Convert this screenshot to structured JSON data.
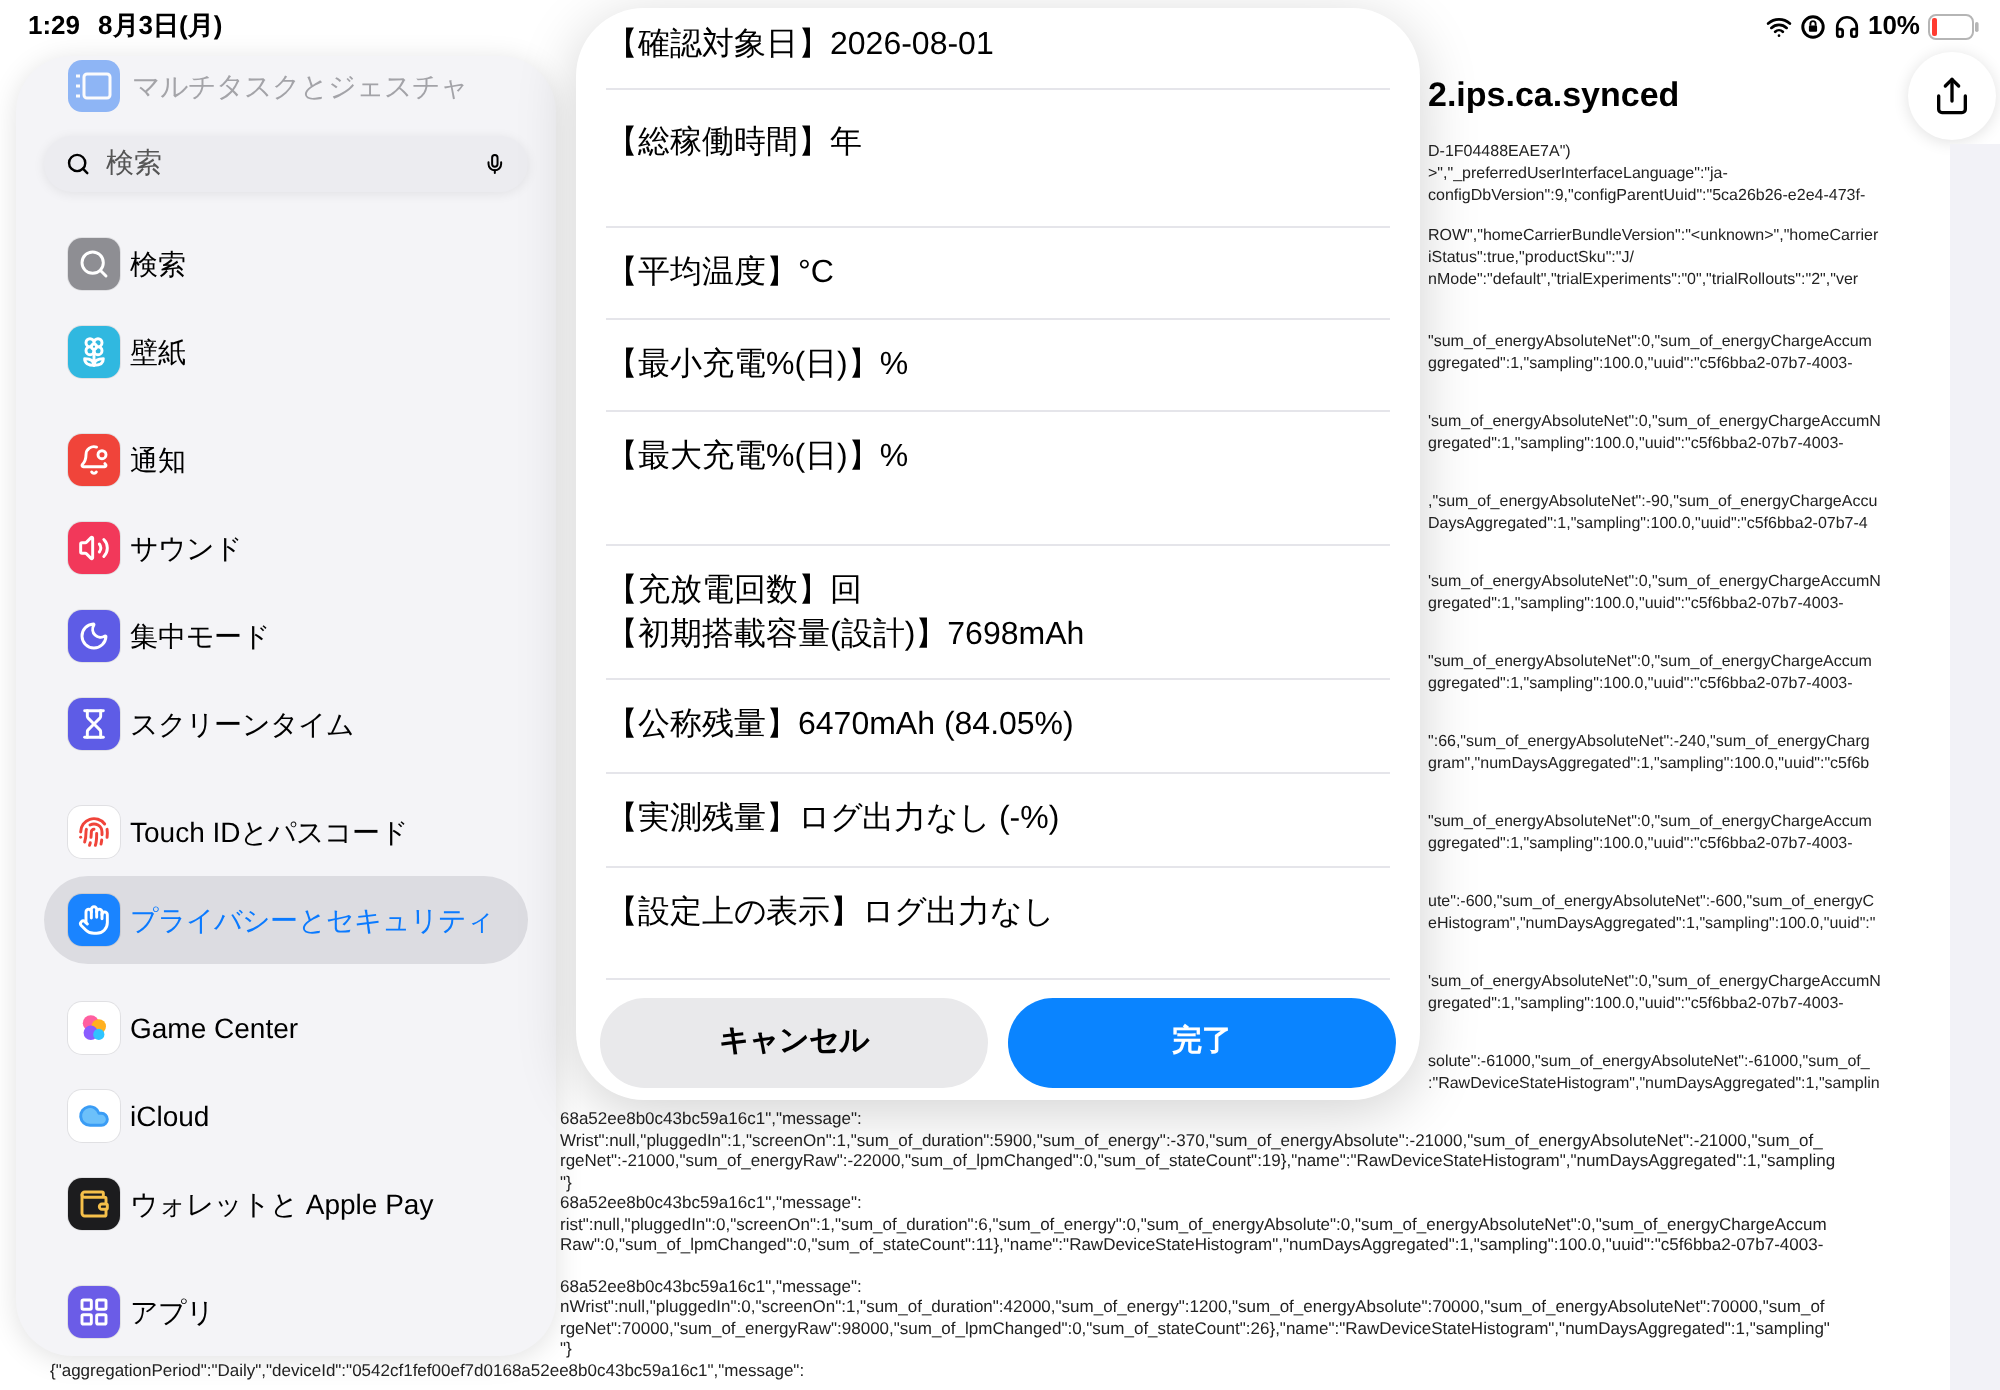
{
  "status_bar": {
    "time": "1:29",
    "date": "8月3日(月)",
    "battery": "10%"
  },
  "document": {
    "title": "2.ips.ca.synced",
    "upper_log": [
      [
        "D-1F04488EAE7A\")",
        ">\",\"_preferredUserInterfaceLanguage\":\"ja-",
        "configDbVersion\":9,\"configParentUuid\":\"5ca26b26-e2e4-473f-"
      ],
      [
        "ROW\",\"homeCarrierBundleVersion\":\"<unknown>\",\"homeCarrier",
        "iStatus\":true,\"productSku\":\"J/",
        "nMode\":\"default\",\"trialExperiments\":\"0\",\"trialRollouts\":\"2\",\"ver"
      ],
      [
        "\"sum_of_energyAbsoluteNet\":0,\"sum_of_energyChargeAccum",
        "ggregated\":1,\"sampling\":100.0,\"uuid\":\"c5f6bba2-07b7-4003-"
      ],
      [
        "'sum_of_energyAbsoluteNet\":0,\"sum_of_energyChargeAccumN",
        "gregated\":1,\"sampling\":100.0,\"uuid\":\"c5f6bba2-07b7-4003-"
      ],
      [
        ",\"sum_of_energyAbsoluteNet\":-90,\"sum_of_energyChargeAccu",
        "DaysAggregated\":1,\"sampling\":100.0,\"uuid\":\"c5f6bba2-07b7-4"
      ],
      [
        "'sum_of_energyAbsoluteNet\":0,\"sum_of_energyChargeAccumN",
        "gregated\":1,\"sampling\":100.0,\"uuid\":\"c5f6bba2-07b7-4003-"
      ],
      [
        "\"sum_of_energyAbsoluteNet\":0,\"sum_of_energyChargeAccum",
        "ggregated\":1,\"sampling\":100.0,\"uuid\":\"c5f6bba2-07b7-4003-"
      ],
      [
        "\":66,\"sum_of_energyAbsoluteNet\":-240,\"sum_of_energyCharg",
        "gram\",\"numDaysAggregated\":1,\"sampling\":100.0,\"uuid\":\"c5f6b"
      ],
      [
        "\"sum_of_energyAbsoluteNet\":0,\"sum_of_energyChargeAccum",
        "ggregated\":1,\"sampling\":100.0,\"uuid\":\"c5f6bba2-07b7-4003-"
      ],
      [
        "ute\":-600,\"sum_of_energyAbsoluteNet\":-600,\"sum_of_energyC",
        "eHistogram\",\"numDaysAggregated\":1,\"sampling\":100.0,\"uuid\":\""
      ],
      [
        "'sum_of_energyAbsoluteNet\":0,\"sum_of_energyChargeAccumN",
        "gregated\":1,\"sampling\":100.0,\"uuid\":\"c5f6bba2-07b7-4003-"
      ],
      [
        "solute\":-61000,\"sum_of_energyAbsoluteNet\":-61000,\"sum_of_",
        ":\"RawDeviceStateHistogram\",\"numDaysAggregated\":1,\"samplin"
      ]
    ],
    "lower_log": [
      [
        "68a52ee8b0c43bc59a16c1\",\"message\":",
        "Wrist\":null,\"pluggedIn\":1,\"screenOn\":1,\"sum_of_duration\":5900,\"sum_of_energy\":-370,\"sum_of_energyAbsolute\":-21000,\"sum_of_energyAbsoluteNet\":-21000,\"sum_of_",
        "rgeNet\":-21000,\"sum_of_energyRaw\":-22000,\"sum_of_lpmChanged\":0,\"sum_of_stateCount\":19},\"name\":\"RawDeviceStateHistogram\",\"numDaysAggregated\":1,\"sampling",
        "\"}",
        "68a52ee8b0c43bc59a16c1\",\"message\":",
        "rist\":null,\"pluggedIn\":0,\"screenOn\":1,\"sum_of_duration\":6,\"sum_of_energy\":0,\"sum_of_energyAbsolute\":0,\"sum_of_energyAbsoluteNet\":0,\"sum_of_energyChargeAccum",
        "Raw\":0,\"sum_of_lpmChanged\":0,\"sum_of_stateCount\":11},\"name\":\"RawDeviceStateHistogram\",\"numDaysAggregated\":1,\"sampling\":100.0,\"uuid\":\"c5f6bba2-07b7-4003-"
      ],
      [
        "68a52ee8b0c43bc59a16c1\",\"message\":",
        "nWrist\":null,\"pluggedIn\":0,\"screenOn\":1,\"sum_of_duration\":42000,\"sum_of_energy\":1200,\"sum_of_energyAbsolute\":70000,\"sum_of_energyAbsoluteNet\":70000,\"sum_of",
        "rgeNet\":70000,\"sum_of_energyRaw\":98000,\"sum_of_lpmChanged\":0,\"sum_of_stateCount\":26},\"name\":\"RawDeviceStateHistogram\",\"numDaysAggregated\":1,\"sampling\"",
        "\"}"
      ]
    ],
    "last_line": "{\"aggregationPeriod\":\"Daily\",\"deviceId\":\"0542cf1fef00ef7d0168a52ee8b0c43bc59a16c1\",\"message\":"
  },
  "sidebar": {
    "faded_item": "マルチタスクとジェスチャ",
    "search": {
      "placeholder": "検索"
    },
    "groups": [
      [
        {
          "label": "検索",
          "color": "#8e8e93",
          "selected": false
        },
        {
          "label": "壁紙",
          "color": "#30b8e0",
          "selected": false
        }
      ],
      [
        {
          "label": "通知",
          "color": "#f0443a",
          "selected": false
        },
        {
          "label": "サウンド",
          "color": "#f2385a",
          "selected": false
        },
        {
          "label": "集中モード",
          "color": "#5e5ce6",
          "selected": false
        },
        {
          "label": "スクリーンタイム",
          "color": "#5e5ce6",
          "selected": false
        }
      ],
      [
        {
          "label": "Touch IDとパスコード",
          "color": "#ffffff",
          "selected": false
        },
        {
          "label": "プライバシーとセキュリティ",
          "color": "#1a84ff",
          "selected": true
        }
      ],
      [
        {
          "label": "Game Center",
          "color": "#ffffff",
          "selected": false
        },
        {
          "label": "iCloud",
          "color": "#ffffff",
          "selected": false
        },
        {
          "label": "ウォレットと Apple Pay",
          "color": "#1c1c1e",
          "selected": false
        }
      ],
      [
        {
          "label": "アプリ",
          "color": "#6b5ce7",
          "selected": false
        }
      ]
    ]
  },
  "dialog": {
    "rows": [
      [
        "【確認対象日】2026-08-01"
      ],
      [
        "【総稼働時間】年"
      ],
      [
        "【平均温度】°C"
      ],
      [
        "【最小充電%(日)】%"
      ],
      [
        "【最大充電%(日)】%"
      ],
      [
        "【充放電回数】回",
        "【初期搭載容量(設計)】7698mAh"
      ],
      [
        "【公称残量】6470mAh (84.05%)"
      ],
      [
        "【実測残量】ログ出力なし (-%)"
      ],
      [
        "【設定上の表示】ログ出力なし"
      ]
    ],
    "buttons": [
      {
        "label": "キャンセル",
        "kind": "secondary"
      },
      {
        "label": "完了",
        "kind": "primary"
      }
    ]
  }
}
